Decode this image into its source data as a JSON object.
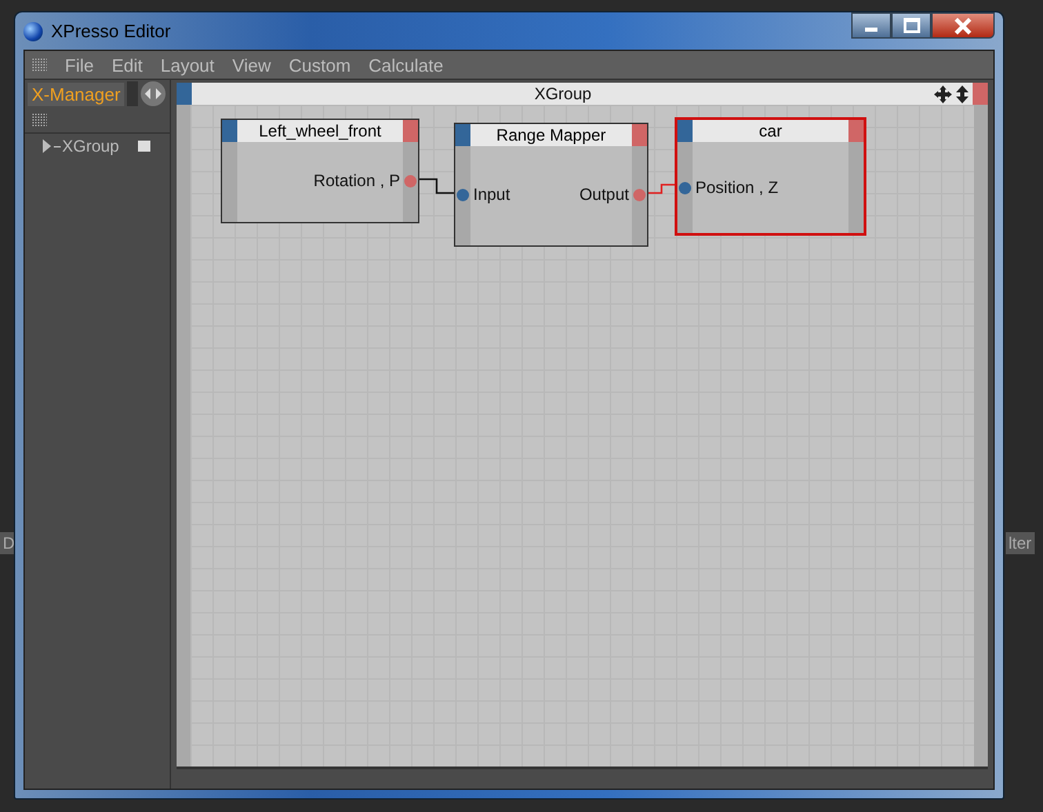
{
  "background": {
    "side_labels": [
      "D",
      "lter"
    ]
  },
  "window": {
    "title": "XPresso Editor"
  },
  "menu": [
    "File",
    "Edit",
    "Layout",
    "View",
    "Custom",
    "Calculate"
  ],
  "manager_tabs": [
    {
      "label": "X-Manager",
      "selected": true
    }
  ],
  "tree": [
    {
      "label": "XGroup",
      "expanded": false
    }
  ],
  "editor": {
    "title": "XGroup"
  },
  "nodes": [
    {
      "title": "Left_wheel_front",
      "selected": false,
      "outputs": [
        "Rotation , P"
      ]
    },
    {
      "title": "Range Mapper",
      "selected": false,
      "inputs": [
        "Input"
      ],
      "outputs": [
        "Output"
      ]
    },
    {
      "title": "car",
      "selected": true,
      "inputs": [
        "Position , Z"
      ]
    }
  ]
}
